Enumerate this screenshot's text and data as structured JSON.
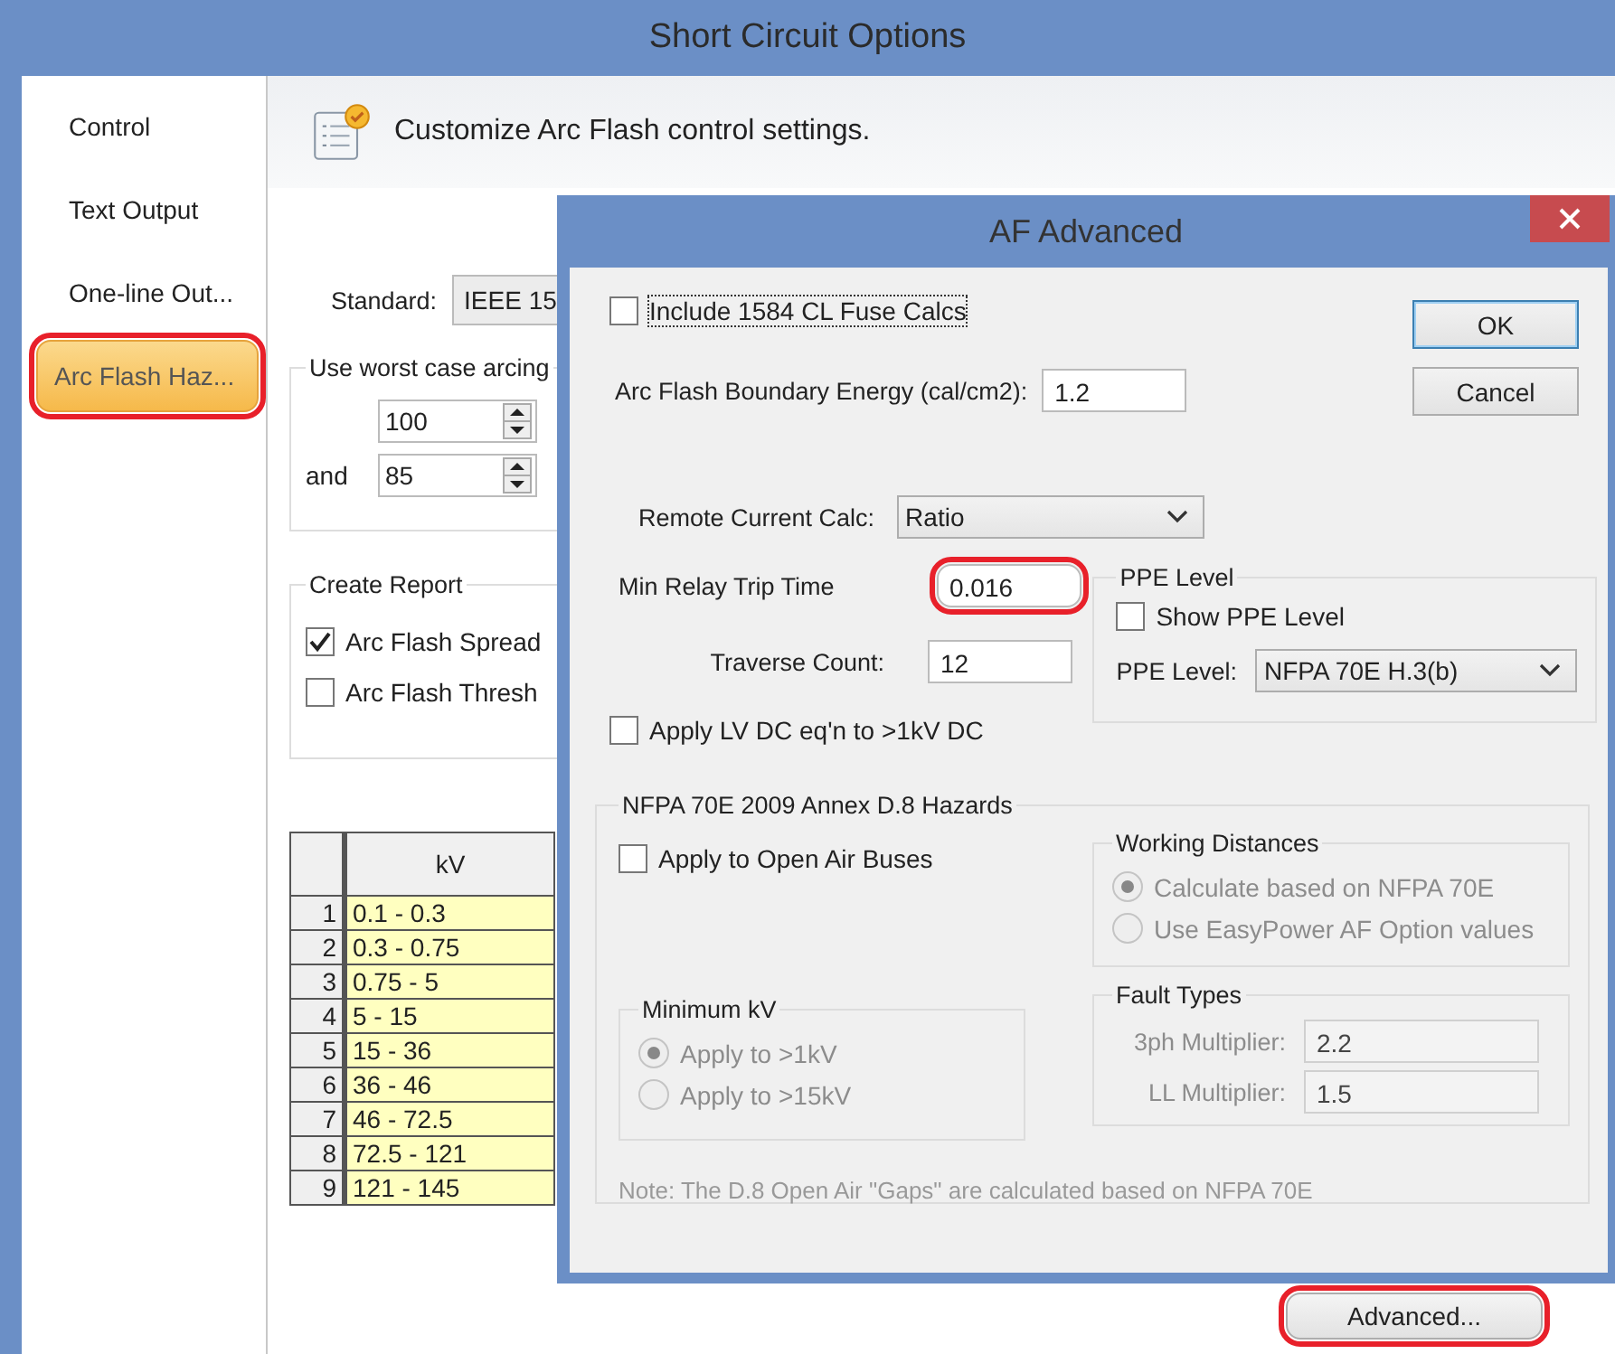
{
  "window": {
    "title": "Short Circuit Options"
  },
  "sidebar": {
    "items": [
      {
        "label": "Control",
        "selected": false,
        "annotated": false
      },
      {
        "label": "Text Output",
        "selected": false,
        "annotated": false
      },
      {
        "label": "One-line Out...",
        "selected": false,
        "annotated": false
      },
      {
        "label": "Arc Flash Haz...",
        "selected": true,
        "annotated": true
      }
    ]
  },
  "header": {
    "text": "Customize Arc Flash control settings."
  },
  "standard": {
    "label": "Standard:",
    "value": "IEEE 15"
  },
  "arcing_group": {
    "title": "Use worst case arcing",
    "spinners": [
      {
        "value": "100"
      },
      {
        "prefix": "and",
        "value": "85"
      }
    ]
  },
  "report_group": {
    "title": "Create Report",
    "options": [
      {
        "label": "Arc Flash Spread",
        "checked": true
      },
      {
        "label": "Arc Flash Thresh",
        "checked": false
      }
    ]
  },
  "table": {
    "columns": [
      "kV"
    ],
    "rows": [
      {
        "index": "1",
        "kv": "0.1 - 0.3"
      },
      {
        "index": "2",
        "kv": "0.3 - 0.75"
      },
      {
        "index": "3",
        "kv": "0.75 - 5"
      },
      {
        "index": "4",
        "kv": "5 - 15"
      },
      {
        "index": "5",
        "kv": "15 - 36"
      },
      {
        "index": "6",
        "kv": "36 - 46"
      },
      {
        "index": "7",
        "kv": "46 - 72.5"
      },
      {
        "index": "8",
        "kv": "72.5 - 121"
      },
      {
        "index": "9",
        "kv": "121 - 145"
      }
    ]
  },
  "advanced_button": {
    "label": "Advanced...",
    "annotated": true
  },
  "dialog": {
    "title": "AF Advanced",
    "include_fuse": {
      "label": "Include 1584 CL Fuse Calcs",
      "checked": false,
      "focused": true
    },
    "boundary_energy": {
      "label": "Arc Flash Boundary Energy (cal/cm2):",
      "value": "1.2"
    },
    "remote_current": {
      "label": "Remote Current Calc:",
      "value": "Ratio"
    },
    "min_relay": {
      "label": "Min Relay Trip Time",
      "value": "0.016",
      "annotated": true
    },
    "traverse": {
      "label": "Traverse Count:",
      "value": "12"
    },
    "apply_lv_dc": {
      "label": "Apply LV DC eq'n to >1kV DC",
      "checked": false
    },
    "ppe_group": {
      "title": "PPE Level",
      "show": {
        "label": "Show PPE Level",
        "checked": false
      },
      "level": {
        "label": "PPE Level:",
        "value": "NFPA 70E H.3(b)"
      }
    },
    "buttons": [
      {
        "label": "OK",
        "default": true
      },
      {
        "label": "Cancel",
        "default": false
      }
    ],
    "nfpa_group": {
      "title": "NFPA 70E 2009 Annex D.8 Hazards",
      "open_air": {
        "label": "Apply to Open Air Buses",
        "checked": false
      },
      "working_distances": {
        "title": "Working Distances",
        "options": [
          {
            "label": "Calculate based on NFPA 70E",
            "selected": true,
            "disabled": true
          },
          {
            "label": "Use EasyPower AF Option values",
            "selected": false,
            "disabled": true
          }
        ]
      },
      "minimum_kv": {
        "title": "Minimum kV",
        "options": [
          {
            "label": "Apply to >1kV",
            "selected": true,
            "disabled": true
          },
          {
            "label": "Apply to >15kV",
            "selected": false,
            "disabled": true
          }
        ]
      },
      "fault_types": {
        "title": "Fault Types",
        "fields": [
          {
            "label": "3ph Multiplier:",
            "value": "2.2",
            "disabled": true
          },
          {
            "label": "LL Multiplier:",
            "value": "1.5",
            "disabled": true
          }
        ]
      },
      "note": "Note: The D.8 Open Air \"Gaps\" are calculated based on NFPA 70E"
    }
  }
}
